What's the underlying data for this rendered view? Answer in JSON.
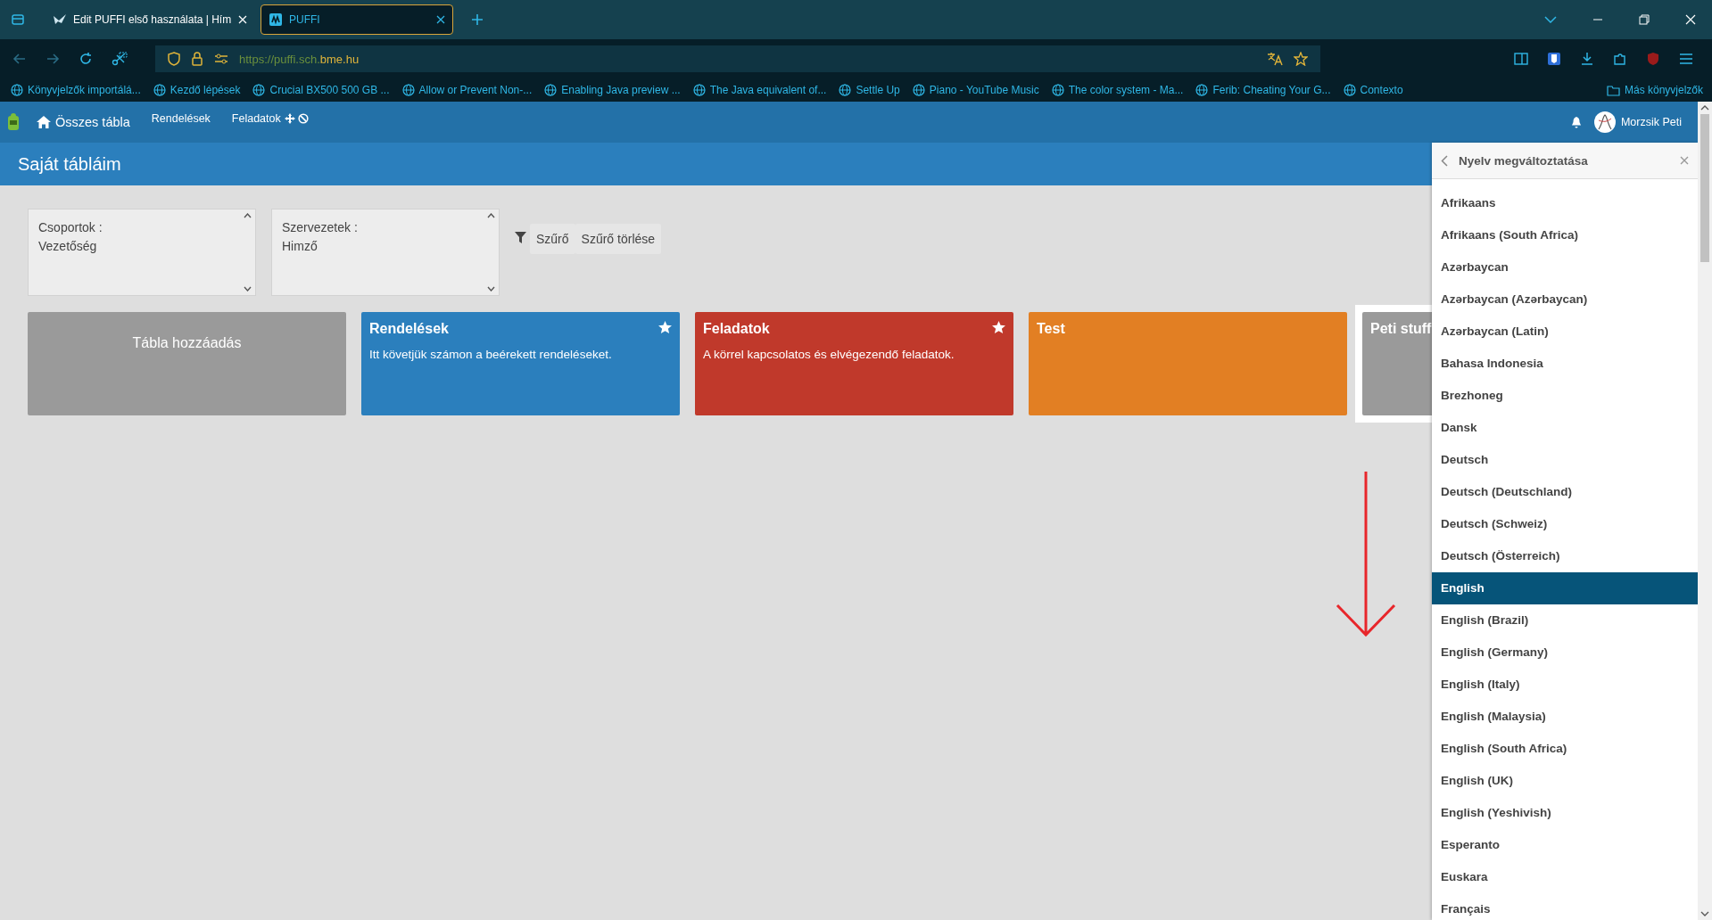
{
  "browser": {
    "tabs": [
      {
        "title": "Edit PUFFI első használata | Hím",
        "selected": false
      },
      {
        "title": "PUFFI",
        "selected": true
      }
    ],
    "url": {
      "prefix": "https://puffi.sch.",
      "domain": "bme.hu"
    },
    "bookmarks": [
      "Könyvjelzők importálá...",
      "Kezdő lépések",
      "Crucial BX500 500 GB ...",
      "Allow or Prevent Non-...",
      "Enabling Java preview ...",
      "The Java equivalent of...",
      "Settle Up",
      "Piano - YouTube Music",
      "The color system - Ma...",
      "Ferib: Cheating Your G...",
      "Contexto"
    ],
    "other_bookmarks": "Más könyvjelzők"
  },
  "nav": {
    "items": [
      {
        "label": "Összes tábla",
        "kind": "home"
      },
      {
        "label": "Rendelések",
        "kind": "link"
      },
      {
        "label": "Feladatok",
        "kind": "link"
      }
    ],
    "user": "Morzsik Peti"
  },
  "page_title": "Saját tábláim",
  "filters": [
    {
      "label": "Csoportok :",
      "value": "Vezetőség"
    },
    {
      "label": "Szervezetek :",
      "value": "Himző"
    }
  ],
  "filter_button": "Szűrő",
  "clear_button": "Szűrő törlése",
  "boards": [
    {
      "kind": "add",
      "title": "Tábla hozzáadás",
      "color": "#9a9a9a"
    },
    {
      "kind": "board",
      "title": "Rendelések",
      "description": "Itt követjük számon a beérekett rendeléseket.",
      "color": "#2b7fbd",
      "starred": true
    },
    {
      "kind": "board",
      "title": "Feladatok",
      "description": "A körrel kapcsolatos és elvégezendő feladatok.",
      "color": "#c0392b",
      "starred": true
    },
    {
      "kind": "board",
      "title": "Test",
      "color": "#e27f23",
      "starred": false
    },
    {
      "kind": "board",
      "title": "Peti stuff",
      "color": "#9a9a9a",
      "starred": false
    }
  ],
  "language_panel": {
    "title": "Nyelv megváltoztatása",
    "items": [
      {
        "label": "Afrikaans",
        "selected": false
      },
      {
        "label": "Afrikaans (South Africa)",
        "selected": false
      },
      {
        "label": "Azərbaycan",
        "selected": false
      },
      {
        "label": "Azərbaycan (Azərbaycan)",
        "selected": false
      },
      {
        "label": "Azərbaycan (Latin)",
        "selected": false
      },
      {
        "label": "Bahasa Indonesia",
        "selected": false
      },
      {
        "label": "Brezhoneg",
        "selected": false
      },
      {
        "label": "Dansk",
        "selected": false
      },
      {
        "label": "Deutsch",
        "selected": false
      },
      {
        "label": "Deutsch (Deutschland)",
        "selected": false
      },
      {
        "label": "Deutsch (Schweiz)",
        "selected": false
      },
      {
        "label": "Deutsch (Österreich)",
        "selected": false
      },
      {
        "label": "English",
        "selected": true
      },
      {
        "label": "English (Brazil)",
        "selected": false
      },
      {
        "label": "English (Germany)",
        "selected": false
      },
      {
        "label": "English (Italy)",
        "selected": false
      },
      {
        "label": "English (Malaysia)",
        "selected": false
      },
      {
        "label": "English (South Africa)",
        "selected": false
      },
      {
        "label": "English (UK)",
        "selected": false
      },
      {
        "label": "English (Yeshivish)",
        "selected": false
      },
      {
        "label": "Esperanto",
        "selected": false
      },
      {
        "label": "Euskara",
        "selected": false
      },
      {
        "label": "Français",
        "selected": false
      }
    ]
  }
}
